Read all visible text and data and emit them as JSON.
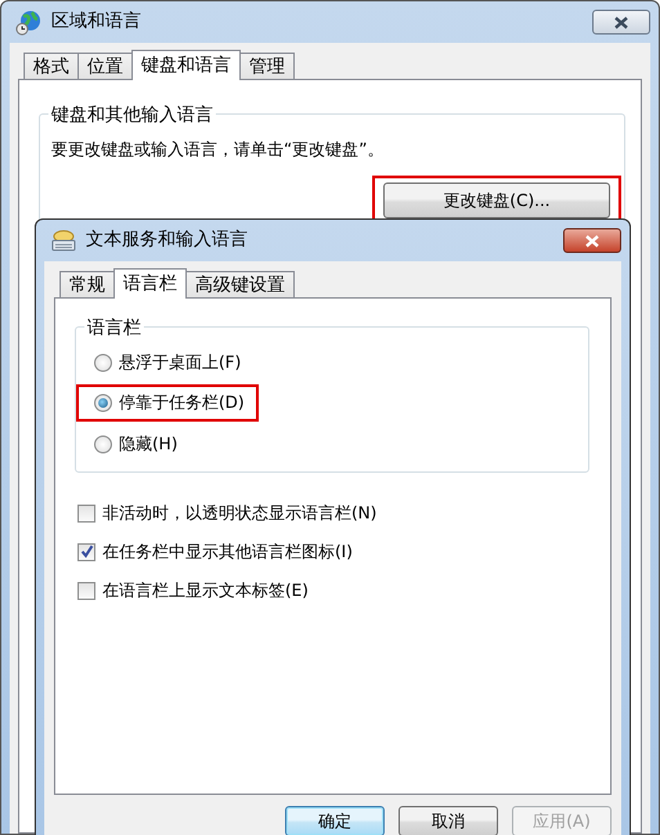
{
  "outer_window": {
    "title": "区域和语言",
    "tabs": [
      {
        "label": "格式",
        "selected": false
      },
      {
        "label": "位置",
        "selected": false
      },
      {
        "label": "键盘和语言",
        "selected": true
      },
      {
        "label": "管理",
        "selected": false
      }
    ],
    "group": {
      "title": "键盘和其他输入语言",
      "text": "要更改键盘或输入语言，请单击“更改键盘”。",
      "button": {
        "label": "更改键盘(C)...",
        "highlighted": true
      }
    }
  },
  "dialog": {
    "title": "文本服务和输入语言",
    "tabs": [
      {
        "label": "常规",
        "selected": false
      },
      {
        "label": "语言栏",
        "selected": true
      },
      {
        "label": "高级键设置",
        "selected": false
      }
    ],
    "group": {
      "title": "语言栏",
      "options": [
        {
          "label": "悬浮于桌面上(F)",
          "selected": false,
          "highlighted": false
        },
        {
          "label": "停靠于任务栏(D)",
          "selected": true,
          "highlighted": true
        },
        {
          "label": "隐藏(H)",
          "selected": false,
          "highlighted": false
        }
      ]
    },
    "checkboxes": [
      {
        "label": "非活动时，以透明状态显示语言栏(N)",
        "checked": false
      },
      {
        "label": "在任务栏中显示其他语言栏图标(I)",
        "checked": true
      },
      {
        "label": "在语言栏上显示文本标签(E)",
        "checked": false
      }
    ],
    "buttons": [
      {
        "label": "确定",
        "kind": "default",
        "disabled": false
      },
      {
        "label": "取消",
        "kind": "normal",
        "disabled": false
      },
      {
        "label": "应用(A)",
        "kind": "normal",
        "disabled": true
      }
    ]
  }
}
